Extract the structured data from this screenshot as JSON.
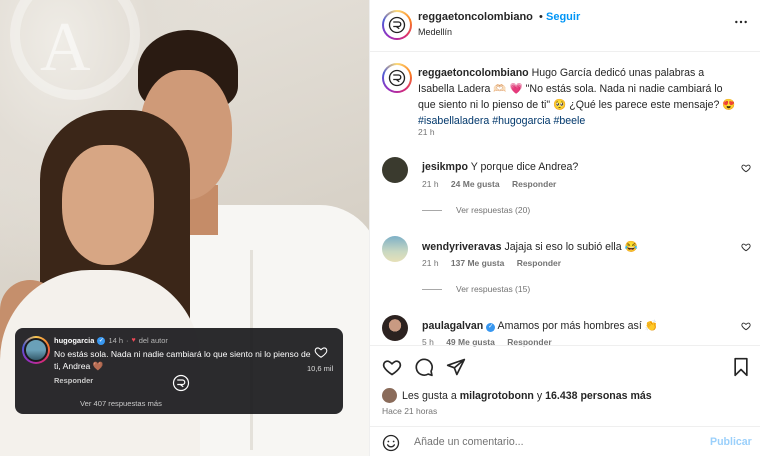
{
  "post": {
    "username": "reggaetoncolombiano",
    "follow_label": "Seguir",
    "location": "Medellín",
    "caption_user": "reggaetoncolombiano",
    "caption_text": "Hugo García dedicó unas palabras a Isabella Ladera 🫶🏻 💗 \"No estás sola. Nada ni nadie cambiará lo que siento ni lo pienso de ti\" 🥺 ¿Qué les parece este mensaje? 😍",
    "hashtags": [
      "#isabellaladera",
      "#hugogarcia",
      "#beele"
    ],
    "caption_time": "21 h"
  },
  "overlay": {
    "username": "hugogarcia",
    "time": "14 h",
    "dot": "·",
    "badge_label": "del autor",
    "text": "No estás sola. Nada ni nadie cambiará lo que siento ni lo pienso de ti, Andrea 🤎",
    "reply_label": "Responder",
    "likes": "10,6 mil",
    "more_replies": "Ver 407 respuestas más"
  },
  "comments": [
    {
      "user": "jesikmpo",
      "text": "Y porque dice Andrea?",
      "time": "21 h",
      "likes": "24 Me gusta",
      "reply": "Responder",
      "replies": "Ver respuestas (20)",
      "avatar_color": "#3a3a2e"
    },
    {
      "user": "wendyriveravas",
      "text": "Jajaja si eso lo subió ella 😂",
      "time": "21 h",
      "likes": "137 Me gusta",
      "reply": "Responder",
      "replies": "Ver respuestas (15)",
      "avatar_color": "#c9d8c2"
    },
    {
      "user": "paulagalvan",
      "text": "Amamos por más hombres así 👏",
      "time": "5 h",
      "likes": "49 Me gusta",
      "reply": "Responder",
      "avatar_color": "#2c2220"
    }
  ],
  "likes_summary": {
    "prefix": "Les gusta a",
    "user": "milagrotobonn",
    "conj": "y",
    "count": "16.438 personas más"
  },
  "posted_ago": "Hace 21 horas",
  "add_comment": {
    "placeholder": "Añade un comentario...",
    "publish_label": "Publicar"
  },
  "colors": {
    "accent_blue": "#0095f6",
    "publish_disabled": "#9bd0fb",
    "heart_red": "#ed4956"
  }
}
